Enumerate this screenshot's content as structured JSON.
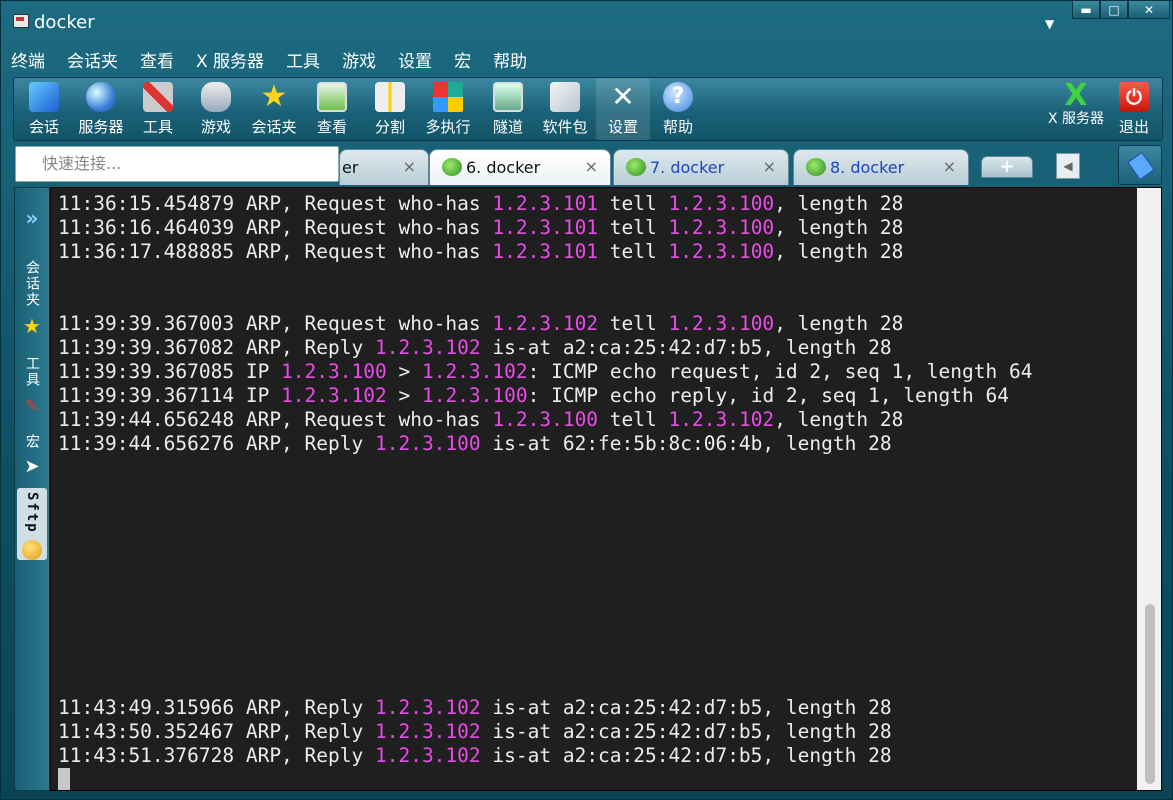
{
  "window": {
    "title": "docker"
  },
  "menu": [
    "终端",
    "会话夹",
    "查看",
    "X 服务器",
    "工具",
    "游戏",
    "设置",
    "宏",
    "帮助"
  ],
  "toolbar": {
    "session": "会话",
    "servers": "服务器",
    "tools": "工具",
    "games": "游戏",
    "sessions": "会话夹",
    "view": "查看",
    "split": "分割",
    "multiexec": "多执行",
    "tunnel": "隧道",
    "packages": "软件包",
    "settings": "设置",
    "help": "帮助",
    "xserver": "X 服务器",
    "exit": "退出"
  },
  "quick_connect": {
    "placeholder": "快速连接..."
  },
  "tabs": [
    {
      "label": "er",
      "close": "×"
    },
    {
      "label": "6. docker",
      "close": "×"
    },
    {
      "label": "7. docker",
      "close": "×"
    },
    {
      "label": "8. docker",
      "close": "×"
    }
  ],
  "sidebar": {
    "sessions": "会话夹",
    "tools": "工具",
    "macros": "宏",
    "sftp": "Sftp"
  },
  "terminal": {
    "lines": [
      [
        {
          "t": "11:36:15.454879 ARP, Request who-has "
        },
        {
          "t": "1.2.3.101",
          "ip": 1
        },
        {
          "t": " tell "
        },
        {
          "t": "1.2.3.100",
          "ip": 1
        },
        {
          "t": ", length 28"
        }
      ],
      [
        {
          "t": "11:36:16.464039 ARP, Request who-has "
        },
        {
          "t": "1.2.3.101",
          "ip": 1
        },
        {
          "t": " tell "
        },
        {
          "t": "1.2.3.100",
          "ip": 1
        },
        {
          "t": ", length 28"
        }
      ],
      [
        {
          "t": "11:36:17.488885 ARP, Request who-has "
        },
        {
          "t": "1.2.3.101",
          "ip": 1
        },
        {
          "t": " tell "
        },
        {
          "t": "1.2.3.100",
          "ip": 1
        },
        {
          "t": ", length 28"
        }
      ],
      [],
      [],
      [
        {
          "t": "11:39:39.367003 ARP, Request who-has "
        },
        {
          "t": "1.2.3.102",
          "ip": 1
        },
        {
          "t": " tell "
        },
        {
          "t": "1.2.3.100",
          "ip": 1
        },
        {
          "t": ", length 28"
        }
      ],
      [
        {
          "t": "11:39:39.367082 ARP, Reply "
        },
        {
          "t": "1.2.3.102",
          "ip": 1
        },
        {
          "t": " is-at a2:ca:25:42:d7:b5, length 28"
        }
      ],
      [
        {
          "t": "11:39:39.367085 IP "
        },
        {
          "t": "1.2.3.100",
          "ip": 1
        },
        {
          "t": " > "
        },
        {
          "t": "1.2.3.102",
          "ip": 1
        },
        {
          "t": ": ICMP echo request, id 2, seq 1, length 64"
        }
      ],
      [
        {
          "t": "11:39:39.367114 IP "
        },
        {
          "t": "1.2.3.102",
          "ip": 1
        },
        {
          "t": " > "
        },
        {
          "t": "1.2.3.100",
          "ip": 1
        },
        {
          "t": ": ICMP echo reply, id 2, seq 1, length 64"
        }
      ],
      [
        {
          "t": "11:39:44.656248 ARP, Request who-has "
        },
        {
          "t": "1.2.3.100",
          "ip": 1
        },
        {
          "t": " tell "
        },
        {
          "t": "1.2.3.102",
          "ip": 1
        },
        {
          "t": ", length 28"
        }
      ],
      [
        {
          "t": "11:39:44.656276 ARP, Reply "
        },
        {
          "t": "1.2.3.100",
          "ip": 1
        },
        {
          "t": " is-at 62:fe:5b:8c:06:4b, length 28"
        }
      ],
      [],
      [],
      [],
      [],
      [],
      [],
      [],
      [],
      [],
      [],
      [
        {
          "t": "11:43:49.315966 ARP, Reply "
        },
        {
          "t": "1.2.3.102",
          "ip": 1
        },
        {
          "t": " is-at a2:ca:25:42:d7:b5, length 28"
        }
      ],
      [
        {
          "t": "11:43:50.352467 ARP, Reply "
        },
        {
          "t": "1.2.3.102",
          "ip": 1
        },
        {
          "t": " is-at a2:ca:25:42:d7:b5, length 28"
        }
      ],
      [
        {
          "t": "11:43:51.376728 ARP, Reply "
        },
        {
          "t": "1.2.3.102",
          "ip": 1
        },
        {
          "t": " is-at a2:ca:25:42:d7:b5, length 28"
        }
      ]
    ]
  },
  "colors": {
    "ip": "#e84ce8",
    "text": "#ececec",
    "bg": "#1f1f1f"
  }
}
